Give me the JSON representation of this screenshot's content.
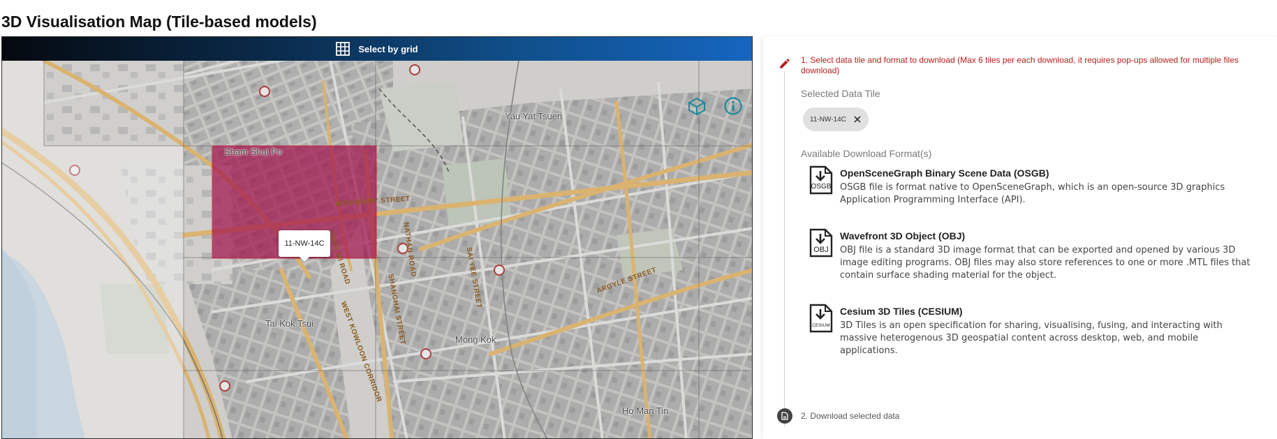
{
  "page": {
    "title": "3D Visualisation Map (Tile-based models)"
  },
  "map": {
    "toolbar_label": "Select by grid",
    "selected_tile_tooltip": "11-NW-14C",
    "place_labels": {
      "sham_shui_po": "Sham Shui Po",
      "yau_yat_tsuen": "Yau Yat Tsuen",
      "tai_kok_tsui": "Tai Kok Tsui",
      "mong_kok": "Mong Kok",
      "ho_man_tin": "Ho Man Tin"
    },
    "road_labels": {
      "boundary_street": "BOUNDARY STREET",
      "tong_mi_road": "TONG MI ROAD",
      "west_kowloon_corridor": "WEST KOWLOON CORRIDOR",
      "shanghai_street": "SHANGHAI STREET",
      "nathan_road": "NATHAN ROAD",
      "sai_yee_street": "SAI YEE STREET",
      "argyle_street": "ARGYLE STREET"
    },
    "colors": {
      "selection_fill": "#a3154d",
      "accent": "#1a8a9a"
    }
  },
  "panel": {
    "step1_text": "1. Select data tile and format to download (Max 6 tiles per each download, it requires pop-ups allowed for multiple files download)",
    "selected_tile_label": "Selected Data Tile",
    "selected_tile_chip": "11-NW-14C",
    "formats_label": "Available Download Format(s)",
    "formats": [
      {
        "icon_text": "OSGB",
        "title": "OpenSceneGraph Binary Scene Data (OSGB)",
        "description": "OSGB file is format native to OpenSceneGraph, which is an open-source 3D graphics Application Programming Interface (API)."
      },
      {
        "icon_text": "OBJ",
        "title": "Wavefront 3D Object (OBJ)",
        "description": "OBJ file is a standard 3D image format that can be exported and opened by various 3D image editing programs. OBJ files may also store references to one or more .MTL files that contain surface shading material for the object."
      },
      {
        "icon_text": "CESIUM",
        "title": "Cesium 3D Tiles (CESIUM)",
        "description": "3D Tiles is an open specification for sharing, visualising, fusing, and interacting with massive heterogenous 3D geospatial content across desktop, web, and mobile applications."
      }
    ],
    "step2_text": "2. Download selected data",
    "colors": {
      "step1": "#b71c1c"
    }
  }
}
